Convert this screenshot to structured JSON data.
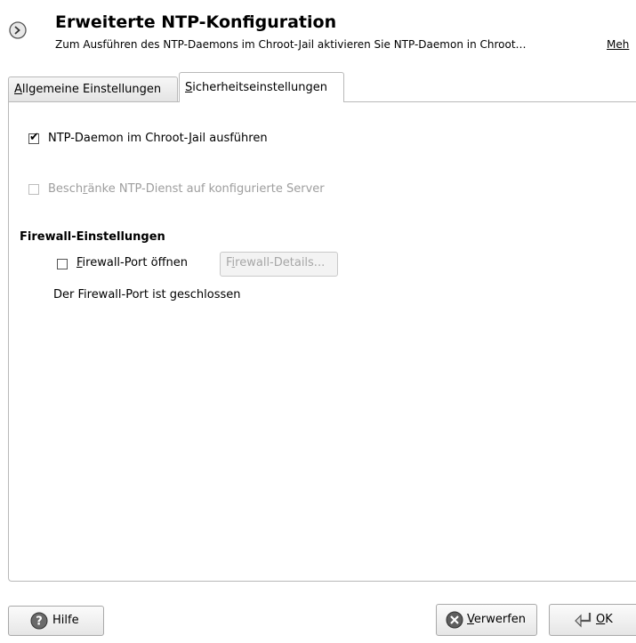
{
  "header": {
    "icon": "clock-settings-icon",
    "title": "Erweiterte NTP-Konfiguration",
    "subtitle": "Zum Ausführen des NTP-Daemons im Chroot-Jail aktivieren Sie NTP-Daemon in Chroot…",
    "more_link": "Meh"
  },
  "tabs": [
    {
      "label_pre": "",
      "label_u": "A",
      "label_post": "llgemeine Einstellungen",
      "active": false
    },
    {
      "label_pre": "",
      "label_u": "S",
      "label_post": "icherheitseinstellungen",
      "active": true
    }
  ],
  "security": {
    "chroot": {
      "label_pre": "NTP-Daemon im Chroot-",
      "label_u": "J",
      "label_post": "ail ausführen",
      "checked": true,
      "enabled": true
    },
    "restrict": {
      "label_pre": "Besch",
      "label_u": "r",
      "label_post": "änke NTP-Dienst auf konfigurierte Server",
      "checked": false,
      "enabled": false
    },
    "firewall": {
      "heading": "Firewall-Einstellungen",
      "open_port": {
        "label_pre": "",
        "label_u": "F",
        "label_post": "irewall-Port öffnen",
        "checked": false
      },
      "details_button": {
        "label_pre": "F",
        "label_u": "i",
        "label_post": "rewall-Details...",
        "enabled": false
      },
      "status": "Der Firewall-Port ist geschlossen"
    }
  },
  "buttons": {
    "help": {
      "label": "Hilfe",
      "icon": "help-icon"
    },
    "discard": {
      "label_u": "V",
      "label_post": "erwerfen",
      "icon": "discard-icon"
    },
    "ok": {
      "label_u": "O",
      "label_post": "K",
      "icon": "return-arrow-icon"
    }
  }
}
